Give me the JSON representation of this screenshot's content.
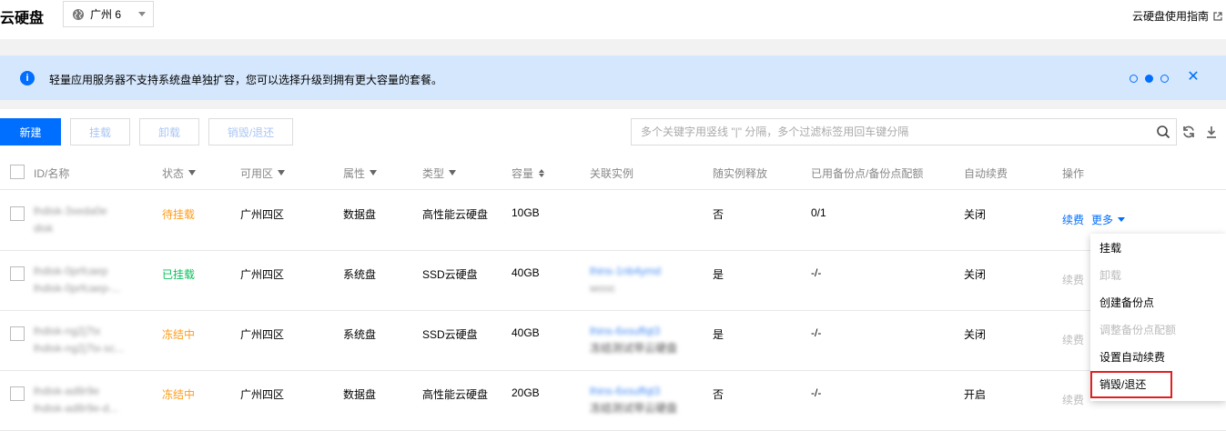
{
  "header": {
    "title": "云硬盘",
    "region": "广州 6",
    "guide_link": "云硬盘使用指南"
  },
  "notice": {
    "info_glyph": "i",
    "text": "轻量应用服务器不支持系统盘单独扩容，您可以选择升级到拥有更大容量的套餐。",
    "close_glyph": "✕",
    "pager": {
      "total": 3,
      "active": 2
    }
  },
  "toolbar": {
    "new_label": "新建",
    "mount_label": "挂载",
    "unmount_label": "卸载",
    "destroy_label": "销毁/退还",
    "search_placeholder": "多个关键字用竖线 \"|\" 分隔，多个过滤标签用回车键分隔"
  },
  "table": {
    "columns": [
      "ID/名称",
      "状态",
      "可用区",
      "属性",
      "类型",
      "容量",
      "关联实例",
      "随实例释放",
      "已用备份点/备份点配额",
      "自动续费",
      "操作"
    ],
    "rows": [
      {
        "id": "lhdisk-3xeda0e",
        "name": "disk",
        "status": "待挂载",
        "status_kind": "warn",
        "zone": "广州四区",
        "attr": "数据盘",
        "type": "高性能云硬盘",
        "size": "10GB",
        "inst_id": "",
        "inst_name": "",
        "release": "否",
        "backup": "0/1",
        "renew": "关闭",
        "op_renew": "续费",
        "op_more": "更多"
      },
      {
        "id": "lhdisk-0prfcaep",
        "name": "lhdisk-0prfcaep-...",
        "status": "已挂载",
        "status_kind": "ok",
        "zone": "广州四区",
        "attr": "系统盘",
        "type": "SSD云硬盘",
        "size": "40GB",
        "inst_id": "lhins-1nb4ymd",
        "inst_name": "wooc",
        "release": "是",
        "backup": "-/-",
        "renew": "关闭",
        "op_renew": "续费",
        "op_more": ""
      },
      {
        "id": "lhdisk-ng2j7tx",
        "name": "lhdisk-ng2j7tx-sc...",
        "status": "冻结中",
        "status_kind": "warn",
        "zone": "广州四区",
        "attr": "系统盘",
        "type": "SSD云硬盘",
        "size": "40GB",
        "inst_id": "lhins-6xsuffqt3",
        "inst_name": "冻结测试带云硬盘",
        "release": "是",
        "backup": "-/-",
        "renew": "关闭",
        "op_renew": "续费",
        "op_more": ""
      },
      {
        "id": "lhdisk-ad8r9e",
        "name": "lhdisk-ad8r9e-d...",
        "status": "冻结中",
        "status_kind": "warn",
        "zone": "广州四区",
        "attr": "数据盘",
        "type": "高性能云硬盘",
        "size": "20GB",
        "inst_id": "lhins-6xsuffqt3",
        "inst_name": "冻结测试带云硬盘",
        "release": "否",
        "backup": "-/-",
        "renew": "开启",
        "op_renew": "续费",
        "op_more": ""
      }
    ]
  },
  "menu": {
    "items": [
      {
        "label": "挂载",
        "disabled": false
      },
      {
        "label": "卸载",
        "disabled": true
      },
      {
        "label": "创建备份点",
        "disabled": false
      },
      {
        "label": "调整备份点配额",
        "disabled": true
      },
      {
        "label": "设置自动续费",
        "disabled": false
      },
      {
        "label": "销毁/退还",
        "disabled": false,
        "highlighted": true
      }
    ]
  },
  "colors": {
    "accent": "#006eff",
    "warn": "#ff9c19",
    "ok": "#0abf5b",
    "notice_bg": "#d5e7fd",
    "highlight_border": "#e02020"
  }
}
